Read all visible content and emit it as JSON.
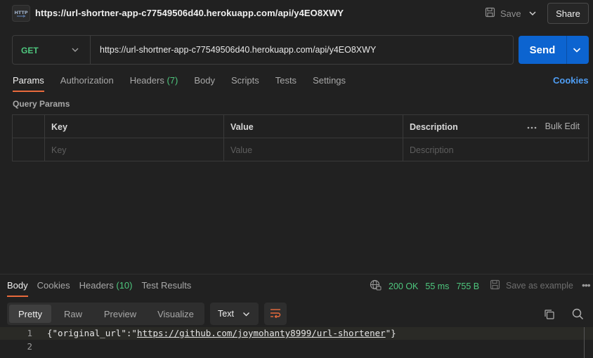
{
  "titlebar": {
    "icon": "http-request-icon",
    "title": "https://url-shortner-app-c77549506d40.herokuapp.com/api/y4EO8XWY",
    "save_label": "Save",
    "share_label": "Share"
  },
  "request": {
    "method": "GET",
    "url": "https://url-shortner-app-c77549506d40.herokuapp.com/api/y4EO8XWY",
    "send_label": "Send"
  },
  "request_tabs": [
    {
      "label": "Params",
      "active": true
    },
    {
      "label": "Authorization"
    },
    {
      "label": "Headers",
      "count": "(7)"
    },
    {
      "label": "Body"
    },
    {
      "label": "Scripts"
    },
    {
      "label": "Tests"
    },
    {
      "label": "Settings"
    }
  ],
  "cookies_label": "Cookies",
  "params": {
    "title": "Query Params",
    "columns": [
      "Key",
      "Value",
      "Description"
    ],
    "placeholders": [
      "Key",
      "Value",
      "Description"
    ],
    "bulk_edit_label": "Bulk Edit"
  },
  "response": {
    "tabs": [
      {
        "label": "Body",
        "active": true
      },
      {
        "label": "Cookies"
      },
      {
        "label": "Headers",
        "count": "(10)"
      },
      {
        "label": "Test Results"
      }
    ],
    "status": "200 OK",
    "time": "55 ms",
    "size": "755 B",
    "save_example_label": "Save as example",
    "more": "•••",
    "view_modes": [
      "Pretty",
      "Raw",
      "Preview",
      "Visualize"
    ],
    "active_view": "Pretty",
    "format": "Text",
    "lines": [
      {
        "num": "1",
        "prefix": "{\"original_url\":\"",
        "link": "https://github.com/joymohanty8999/url-shortener",
        "suffix": "\"}"
      },
      {
        "num": "2",
        "prefix": "",
        "link": "",
        "suffix": ""
      }
    ]
  },
  "colors": {
    "accent_send": "#0c64d0",
    "method_get": "#4ec77e",
    "status_ok": "#4ec77e",
    "active_tab_underline": "#e86a3c",
    "link": "#4f9ef5"
  }
}
